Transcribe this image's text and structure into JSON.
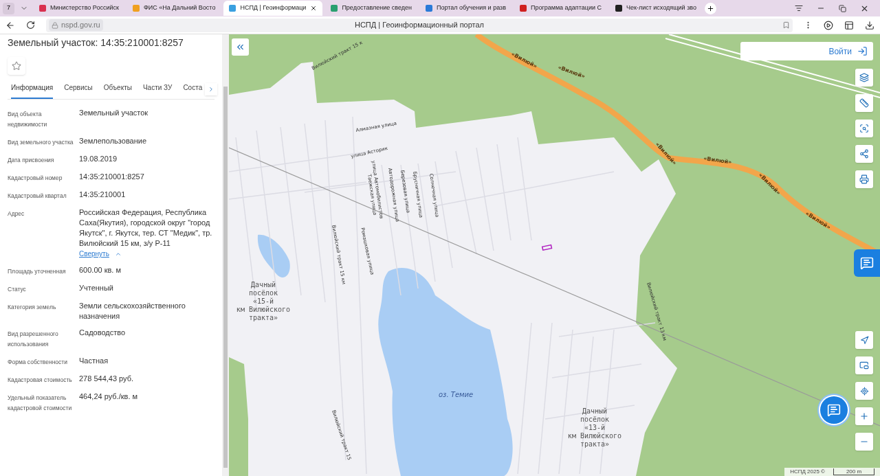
{
  "browser": {
    "tab_count": "7",
    "tabs": [
      {
        "title": "Министерство Российск",
        "selected": false,
        "color": "#d9304f"
      },
      {
        "title": "ФИС «На Дальний Восто",
        "selected": false,
        "color": "#f0a020"
      },
      {
        "title": "НСПД | Геоинформаци",
        "selected": true,
        "color": "#3aa0e0"
      },
      {
        "title": "Предоставление сведен",
        "selected": false,
        "color": "#2aa070"
      },
      {
        "title": "Портал обучения и разв",
        "selected": false,
        "color": "#2a7ad8"
      },
      {
        "title": "Программа адаптации С",
        "selected": false,
        "color": "#d02020"
      },
      {
        "title": "Чек-лист исходящий зво",
        "selected": false,
        "color": "#202020"
      }
    ],
    "url": "nspd.gov.ru",
    "page_title": "НСПД | Геоинформационный портал"
  },
  "panel": {
    "title": "Земельный участок: 14:35:210001:8257",
    "tabs": [
      {
        "label": "Информация",
        "selected": true
      },
      {
        "label": "Сервисы",
        "selected": false
      },
      {
        "label": "Объекты",
        "selected": false
      },
      {
        "label": "Части ЗУ",
        "selected": false
      },
      {
        "label": "Соста",
        "selected": false
      }
    ],
    "fields": [
      {
        "label": "Вид объекта недвижимости",
        "value": "Земельный участок"
      },
      {
        "label": "Вид земельного участка",
        "value": "Землепользование"
      },
      {
        "label": "Дата присвоения",
        "value": "19.08.2019"
      },
      {
        "label": "Кадастровый номер",
        "value": "14:35:210001:8257"
      },
      {
        "label": "Кадастровый квартал",
        "value": "14:35:210001"
      },
      {
        "label": "Адрес",
        "value": "Российская Федерация, Республика Саха(Якутия), городской округ \"город Якутск\", г. Якутск, тер. СТ \"Медик\", тр. Вилюйский 15 км, з/у Р-11",
        "link": "Свернуть"
      },
      {
        "label": "Площадь уточненная",
        "value": "600.00 кв. м"
      },
      {
        "label": "Статус",
        "value": "Учтенный"
      },
      {
        "label": "Категория земель",
        "value": "Земли сельскохозяйственного назначения"
      },
      {
        "label": "Вид разрешенного использования",
        "value": "Садоводство"
      },
      {
        "label": "Форма собственности",
        "value": "Частная"
      },
      {
        "label": "Кадастровая стоимость",
        "value": "278 544,43 руб."
      },
      {
        "label": "Удельный показатель кадастровой стоимости",
        "value": "464,24 руб./кв. м"
      }
    ]
  },
  "map": {
    "login": "Войти",
    "labels": [
      {
        "kind": "road",
        "text": "Вилюйский тракт 15 к"
      },
      {
        "kind": "street",
        "text": "Алмазная улица"
      },
      {
        "kind": "street",
        "text": "улица Асторик"
      },
      {
        "kind": "street",
        "text": "улица Автомобилистов"
      },
      {
        "kind": "street",
        "text": "Таежская улица"
      },
      {
        "kind": "street",
        "text": "Автодорожная улица"
      },
      {
        "kind": "street",
        "text": "Березовая улица"
      },
      {
        "kind": "street",
        "text": "Брусничная улица"
      },
      {
        "kind": "street",
        "text": "Солнечная улица"
      },
      {
        "kind": "street",
        "text": "Ромашковая улица"
      },
      {
        "kind": "street",
        "text": "Вилюйский тракт 15 км"
      },
      {
        "kind": "highway",
        "text": "«Вилюй»"
      },
      {
        "kind": "highway",
        "text": "«Вилюй»"
      },
      {
        "kind": "highway",
        "text": "«Вилюй»"
      },
      {
        "kind": "highway",
        "text": "«Вилюй»"
      },
      {
        "kind": "highway",
        "text": "«Вилюй»"
      },
      {
        "kind": "highway",
        "text": "«Вилюй»"
      },
      {
        "kind": "street",
        "text": "Вилюйский тракт 13 км"
      },
      {
        "kind": "water",
        "text": "оз. Темие"
      },
      {
        "kind": "street",
        "text": "Вилюйский тракт 15"
      }
    ],
    "places": [
      {
        "lines": [
          "Дачный",
          "посёлок",
          "«15-й",
          "км Вилюйского",
          "тракта»"
        ]
      },
      {
        "lines": [
          "Дачный",
          "посёлок",
          "«13-й",
          "км Вилюйского",
          "тракта»"
        ]
      }
    ],
    "copyright": "НСПД 2025 ©",
    "scale": "200 m"
  }
}
